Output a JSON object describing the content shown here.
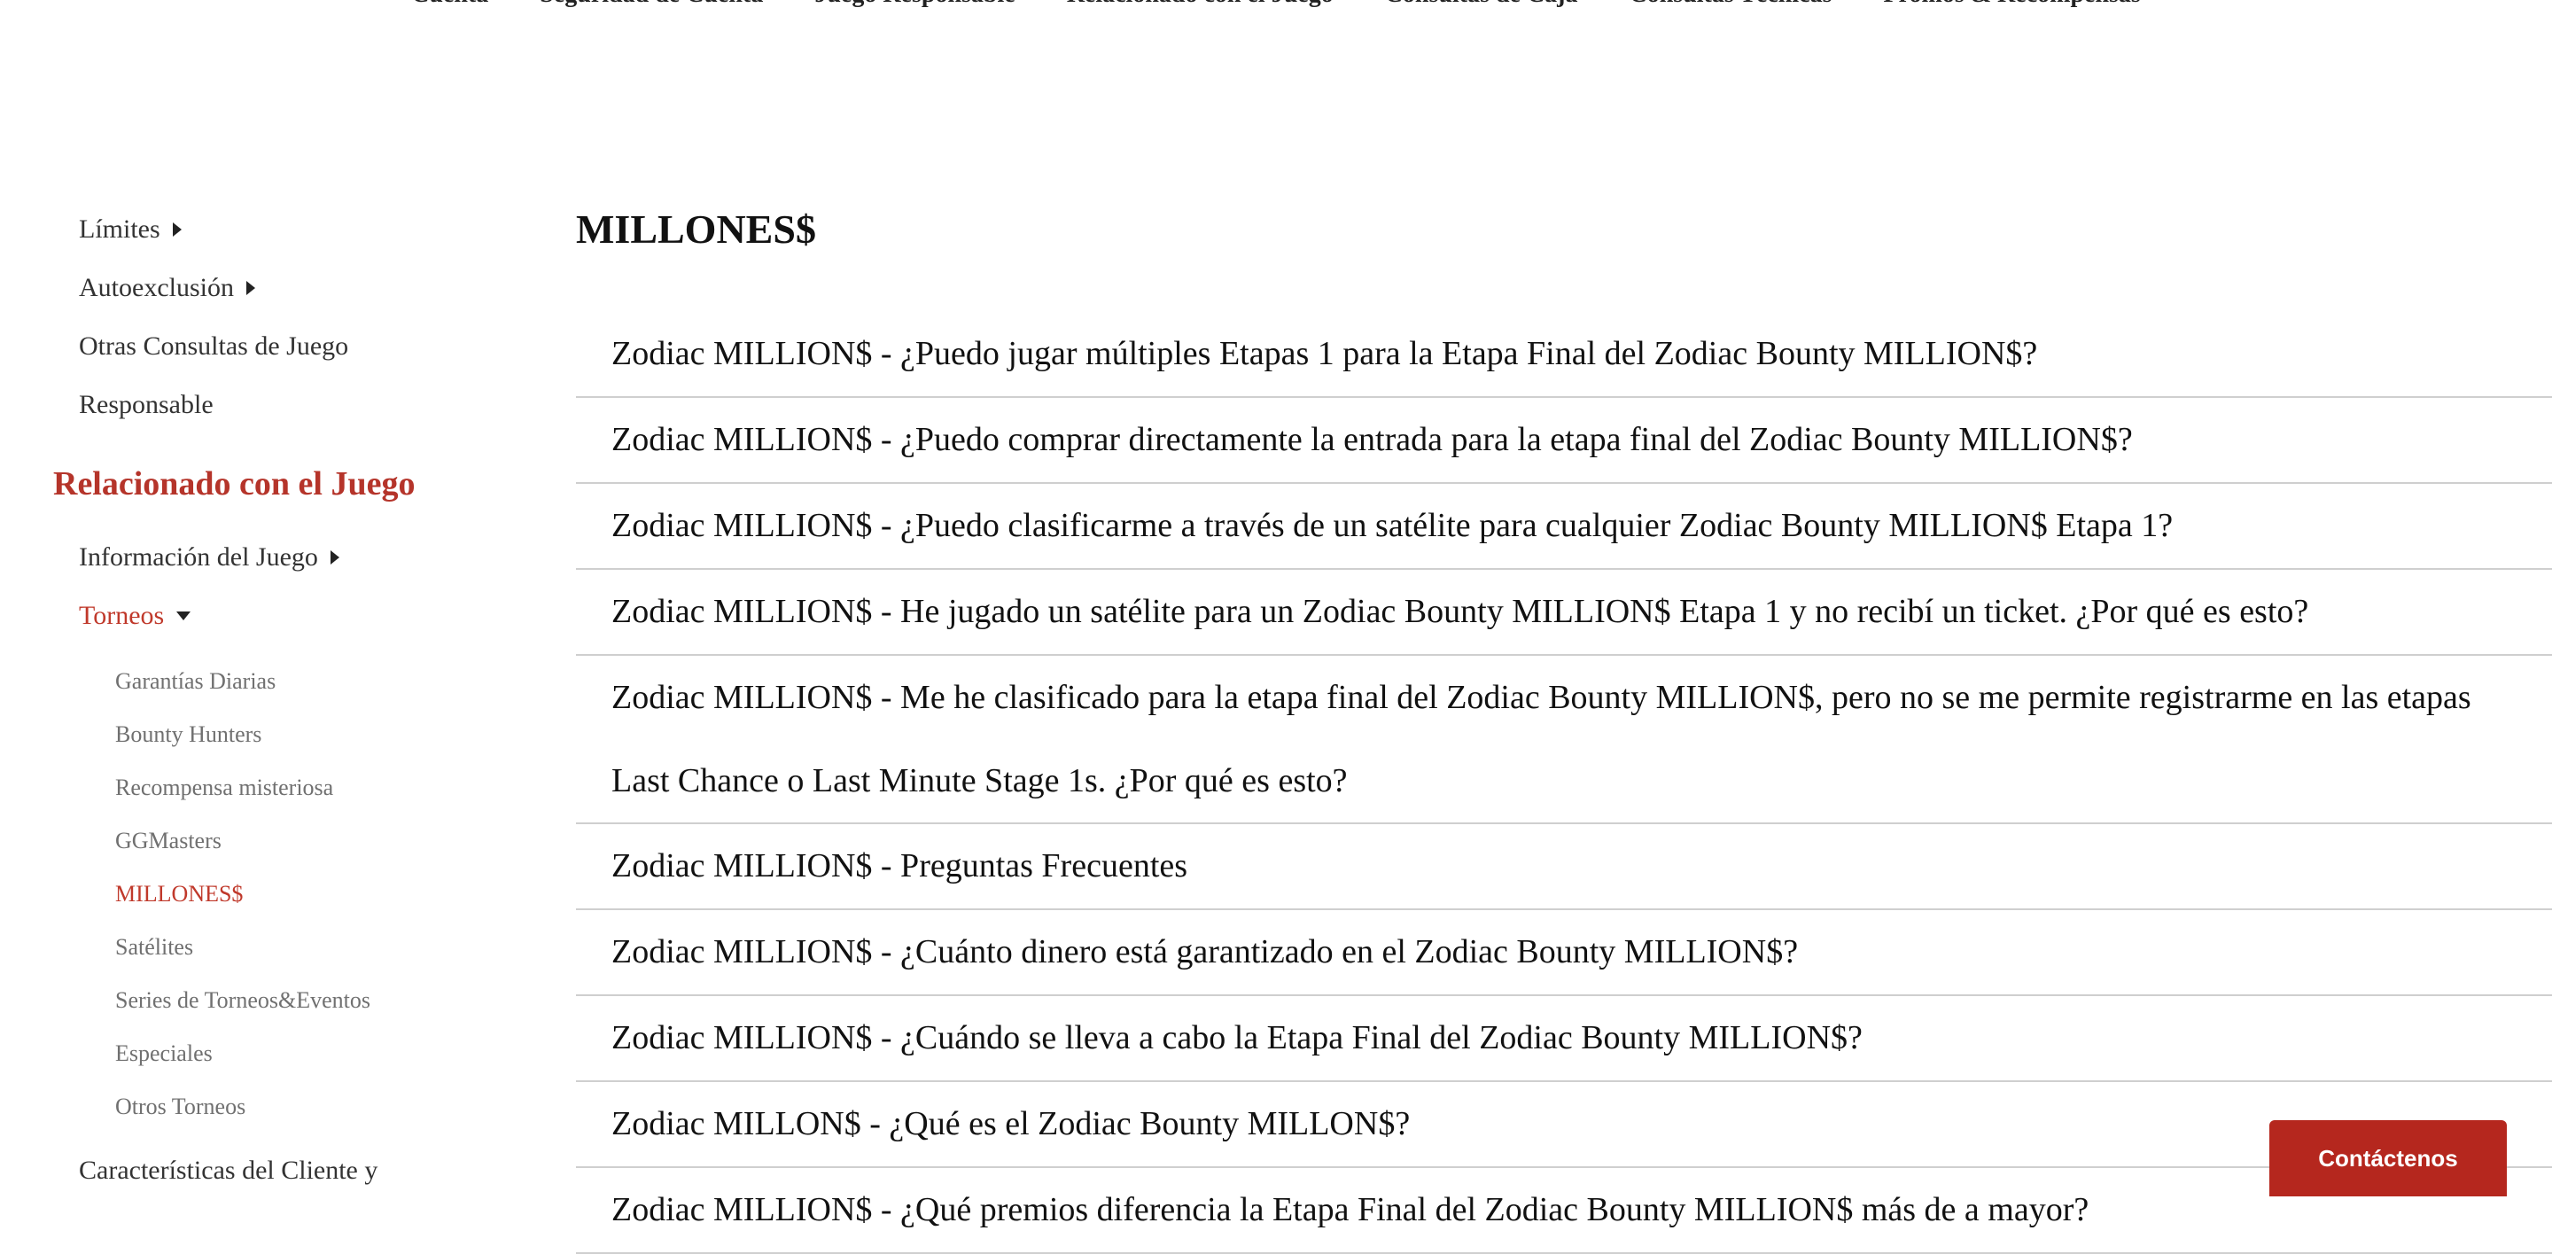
{
  "top_nav": [
    "Cuenta",
    "Seguridad de Cuenta",
    "Juego Responsable",
    "Relacionado con el Juego",
    "Consultas de Caja",
    "Consultas Técnicas",
    "Promos & Recompensas"
  ],
  "sidebar": {
    "items_top": [
      {
        "label": "Límites",
        "caret": "right"
      },
      {
        "label": "Autoexclusión",
        "caret": "right"
      },
      {
        "label": "Otras Consultas de Juego",
        "caret": ""
      },
      {
        "label": "Responsable",
        "caret": ""
      }
    ],
    "heading": "Relacionado con el Juego",
    "items_section": [
      {
        "label": "Información del Juego",
        "caret": "right"
      },
      {
        "label": "Torneos",
        "caret": "down"
      }
    ],
    "subitems": [
      "Garantías Diarias",
      "Bounty Hunters",
      "Recompensa misteriosa",
      "GGMasters",
      "MILLONES$",
      "Satélites",
      "Series de Torneos&Eventos",
      "Especiales",
      "Otros Torneos"
    ],
    "active_subitem": "MILLONES$",
    "items_bottom": [
      {
        "label": "Características del Cliente y"
      }
    ]
  },
  "main": {
    "title": "MILLONES$",
    "faqs": [
      "Zodiac MILLION$ - ¿Puedo jugar múltiples Etapas 1 para la Etapa Final del Zodiac Bounty MILLION$?",
      "Zodiac MILLION$ - ¿Puedo comprar directamente la entrada para la etapa final del Zodiac Bounty MILLION$?",
      "Zodiac MILLION$ - ¿Puedo clasificarme a través de un satélite para cualquier Zodiac Bounty MILLION$ Etapa 1?",
      "Zodiac MILLION$ - He jugado un satélite para un Zodiac Bounty MILLION$ Etapa 1 y no recibí un ticket. ¿Por qué es esto?",
      "Zodiac MILLION$ - Me he clasificado para la etapa final del Zodiac Bounty MILLION$, pero no se me permite registrarme en las etapas Last Chance o Last Minute Stage 1s. ¿Por qué es esto?",
      "Zodiac MILLION$ - Preguntas Frecuentes",
      "Zodiac MILLION$ - ¿Cuánto dinero está garantizado en el Zodiac Bounty MILLION$?",
      "Zodiac MILLION$ - ¿Cuándo se lleva a cabo la Etapa Final del Zodiac Bounty MILLION$?",
      "Zodiac MILLON$ - ¿Qué es el Zodiac Bounty MILLON$?",
      "Zodiac MILLION$ - ¿Qué premios diferencia la Etapa Final del Zodiac Bounty MILLION$ más de a mayor?"
    ]
  },
  "contact_button": "Contáctenos",
  "colors": {
    "accent": "#b5342a",
    "button": "#b5271e",
    "divider": "#cfcfcf"
  }
}
